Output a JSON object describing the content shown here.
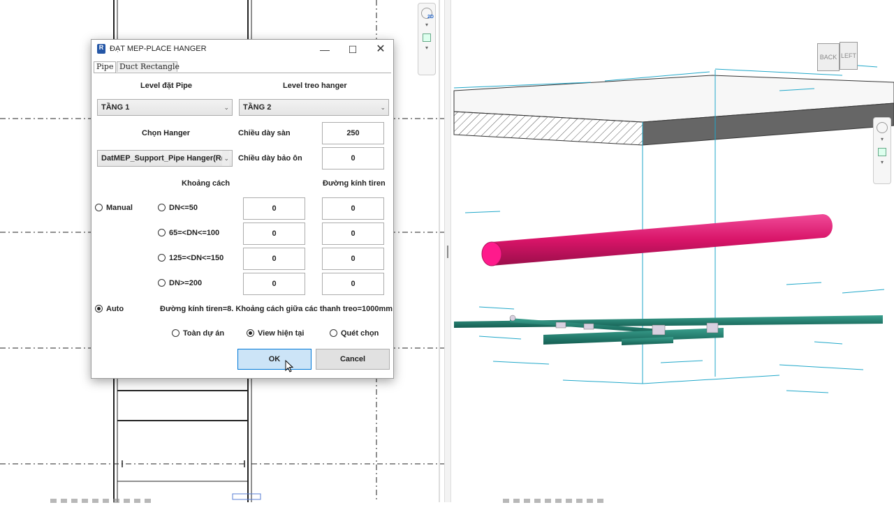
{
  "dialog": {
    "title": "ĐẠT MEP-PLACE HANGER",
    "app_icon_letter": "R",
    "tabs": [
      {
        "label": "Pipe",
        "active": true
      },
      {
        "label": "Duct Rectangle",
        "active": false
      }
    ],
    "level_pipe": {
      "label": "Level đặt Pipe",
      "value": "TẦNG 1"
    },
    "level_hanger": {
      "label": "Level treo hanger",
      "value": "TẦNG 2"
    },
    "hanger": {
      "label": "Chọn Hanger",
      "value": "DatMEP_Support_Pipe Hanger(R("
    },
    "slab_thickness": {
      "label": "Chiều dày sàn",
      "value": "250"
    },
    "insulation_thickness": {
      "label": "Chiều dày bảo ôn",
      "value": "0"
    },
    "spacing_header": "Khoảng cách",
    "rod_diameter_header": "Đường kính tiren",
    "mode_manual": {
      "label": "Manual",
      "checked": false
    },
    "mode_auto": {
      "label": "Auto",
      "checked": true
    },
    "rows": [
      {
        "label": "DN<=50",
        "spacing": "0",
        "rod": "0"
      },
      {
        "label": "65=<DN<=100",
        "spacing": "0",
        "rod": "0"
      },
      {
        "label": "125=<DN<=150",
        "spacing": "0",
        "rod": "0"
      },
      {
        "label": "DN>=200",
        "spacing": "0",
        "rod": "0"
      }
    ],
    "auto_note": "Đường kính tiren=8. Khoảng cách giữa các thanh treo=1000mm",
    "scope": [
      {
        "label": "Toàn dự án",
        "checked": false
      },
      {
        "label": "View hiện tại",
        "checked": true
      },
      {
        "label": "Quét chọn",
        "checked": false
      }
    ],
    "ok_label": "OK",
    "cancel_label": "Cancel"
  },
  "viewport": {
    "navbar_2d_label": "2D",
    "viewcube_faces": [
      "BACK",
      "LEFT"
    ]
  },
  "colors": {
    "pipe_magenta": "#e0176f",
    "pipe_teal": "#1a7a6a",
    "grid_cyan": "#1fa7c9",
    "ok_button": "#cce4f7"
  }
}
